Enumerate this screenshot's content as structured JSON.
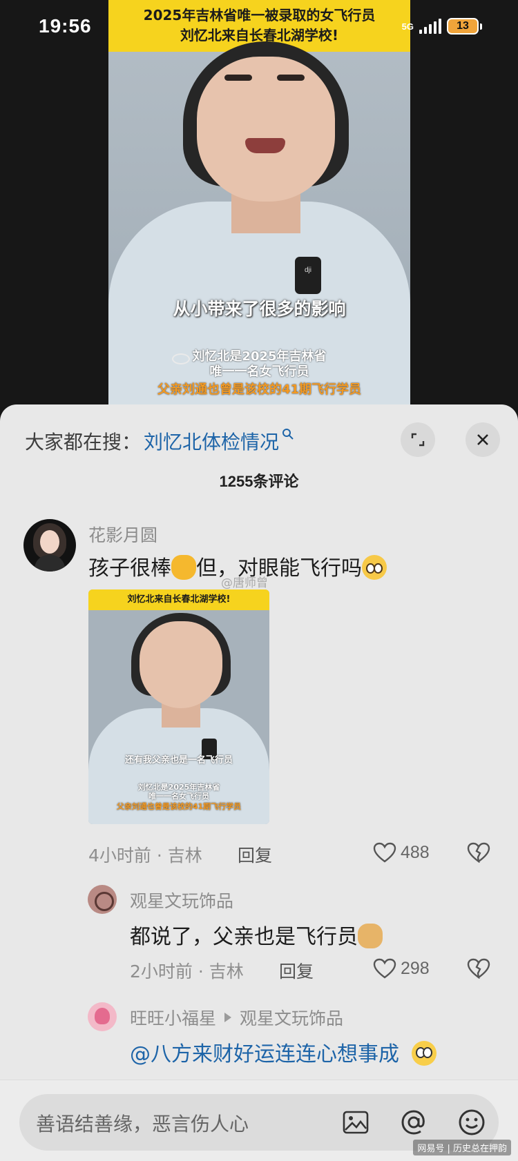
{
  "status_bar": {
    "time": "19:56",
    "network": "5G",
    "battery": "13"
  },
  "video": {
    "banner_line1": "2025年吉林省唯一被录取的女飞行员",
    "banner_line2": "刘忆北来自长春北湖学校!",
    "mic_label": "dji",
    "subtitle": "从小带来了很多的影响",
    "info_line1": "刘忆北是2025年吉林省",
    "info_line2": "唯一一名女飞行员",
    "info_line3": "父亲刘通也曾是该校的41期飞行学员"
  },
  "search": {
    "prefix": "大家都在搜：",
    "term": "刘忆北体检情况"
  },
  "comments_header": "1255条评论",
  "comments": [
    {
      "user": "花影月圆",
      "text_before": "孩子很棒",
      "text_after": "但，对眼能飞行吗",
      "watermark": "@唐师曾",
      "image": {
        "banner": "刘忆北来自长春北湖学校!",
        "subtitle": "还有我父亲也是一名飞行员",
        "info_line1": "刘忆北是2025年吉林省",
        "info_line2": "唯一一名女飞行员",
        "info_line3": "父亲刘通也曾是该校的41期飞行学员"
      },
      "meta": "4小时前 · 吉林",
      "reply_label": "回复",
      "likes": "488"
    },
    {
      "user": "观星文玩饰品",
      "text": "都说了，父亲也是飞行员",
      "meta": "2小时前 · 吉林",
      "reply_label": "回复",
      "likes": "298"
    },
    {
      "user": "旺旺小福星",
      "reply_to": "观星文玩饰品",
      "text": "@八方来财好运连连心想事成"
    }
  ],
  "input": {
    "placeholder": "善语结善缘，恶言伤人心"
  },
  "source_tag": "网易号 | 历史总在押韵",
  "colors": {
    "banner": "#f6d31e",
    "link": "#1d64a8",
    "panel": "#e8e8e8",
    "subtitle_orange": "#f49a22"
  }
}
